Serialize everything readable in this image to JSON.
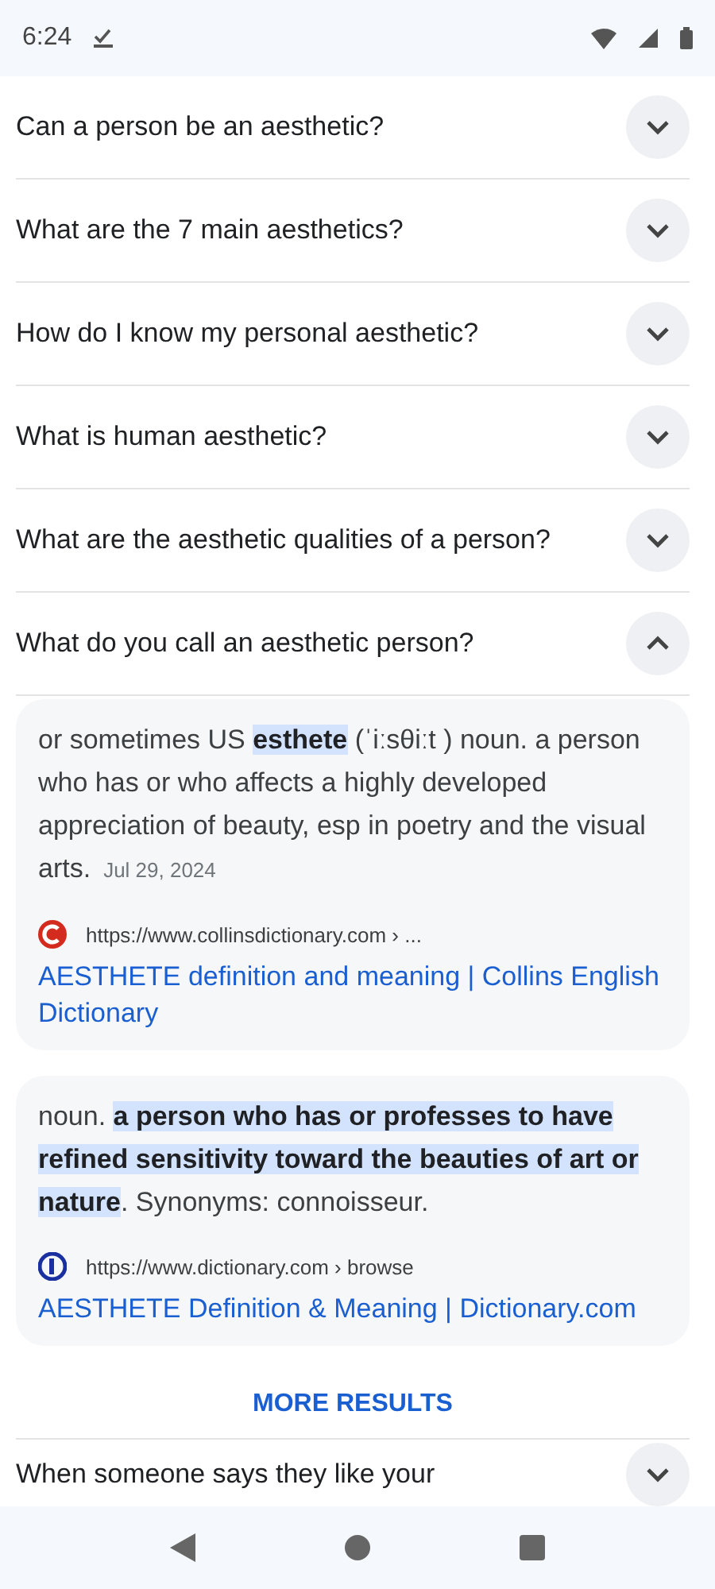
{
  "status_bar": {
    "time": "6:24"
  },
  "questions": [
    {
      "text": "Can a person be an aesthetic?",
      "expanded": false
    },
    {
      "text": "What are the 7 main aesthetics?",
      "expanded": false
    },
    {
      "text": "How do I know my personal aesthetic?",
      "expanded": false
    },
    {
      "text": "What is human aesthetic?",
      "expanded": false
    },
    {
      "text": "What are the aesthetic qualities of a person?",
      "expanded": false
    },
    {
      "text": "What do you call an aesthetic person?",
      "expanded": true
    }
  ],
  "answers": [
    {
      "snippet": "or sometimes US **esthete** (ˈiːsθiːt ) noun. a person who has or who affects a highly developed appreciation of beauty, esp in poetry and the visual arts.",
      "date": "Jul 29, 2024",
      "source": "https://www.collinsdictionary.com › ...",
      "title": "AESTHETE definition and meaning | Collins English Dictionary",
      "kind": "collins"
    },
    {
      "snippet": "noun. **a person who has or professes to have refined sensitivity toward the beauties of art or nature**. Synonyms: connoisseur.",
      "source": "https://www.dictionary.com › browse",
      "title": "AESTHETE Definition & Meaning | Dictionary.com",
      "kind": "dictionary"
    }
  ],
  "more_results": "MORE RESULTS",
  "next_question": {
    "text": "When someone says they like your"
  }
}
